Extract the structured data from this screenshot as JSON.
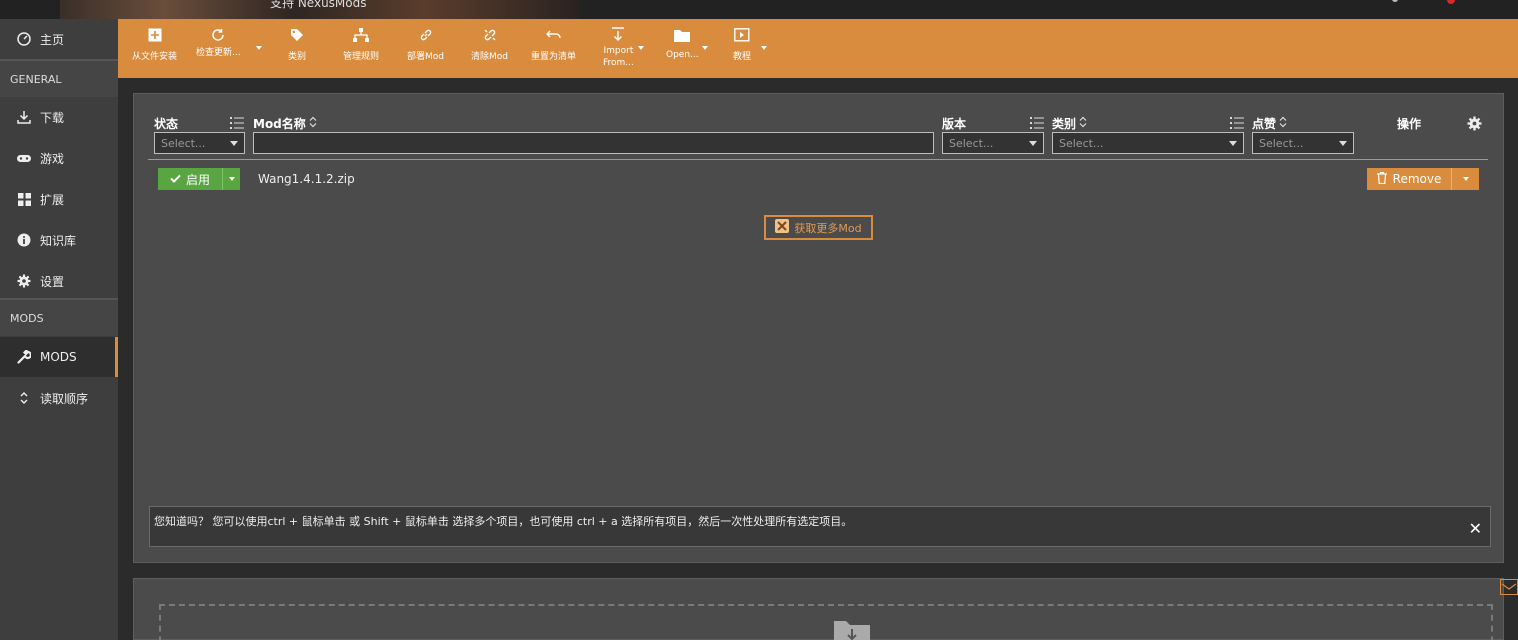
{
  "banner": {
    "text": "支持 NexusMods"
  },
  "sidebar": {
    "items": [
      {
        "label": "主页",
        "icon": "dashboard-icon"
      },
      {
        "label": "下载",
        "icon": "download-icon"
      },
      {
        "label": "游戏",
        "icon": "gamepad-icon"
      },
      {
        "label": "扩展",
        "icon": "grid-icon"
      },
      {
        "label": "知识库",
        "icon": "info-icon"
      },
      {
        "label": "设置",
        "icon": "gear-icon"
      },
      {
        "label": "MODS",
        "icon": "wrench-icon"
      },
      {
        "label": "读取顺序",
        "icon": "sort-icon"
      }
    ],
    "sections": [
      "GENERAL",
      "MODS"
    ],
    "active": "MODS",
    "accent": "#d98c3e"
  },
  "toolbar": {
    "buttons": [
      {
        "label": "从文件安装",
        "icon": "plus-square-icon"
      },
      {
        "label": "检查更新...",
        "icon": "refresh-icon"
      },
      {
        "label": "类别",
        "icon": "tag-icon"
      },
      {
        "label": "管理规则",
        "icon": "hierarchy-icon"
      },
      {
        "label": "部署Mod",
        "icon": "link-icon"
      },
      {
        "label": "清除Mod",
        "icon": "unlink-icon"
      },
      {
        "label": "重置为清单",
        "icon": "undo-icon"
      },
      {
        "label_line1": "Import",
        "label_line2": "From...",
        "icon": "import-icon"
      },
      {
        "label": "Open...",
        "icon": "folder-icon"
      },
      {
        "label": "教程",
        "icon": "video-icon"
      }
    ],
    "color": "#d98c3e"
  },
  "table": {
    "headers": {
      "status": "状态",
      "name": "Mod名称",
      "version": "版本",
      "category": "类别",
      "endorse": "点赞",
      "actions": "操作"
    },
    "filters": {
      "status": "Select...",
      "version": "Select...",
      "category": "Select...",
      "endorse": "Select...",
      "name": ""
    },
    "rows": [
      {
        "status": "启用",
        "name": "Wang1.4.1.2.zip",
        "action": "Remove"
      }
    ]
  },
  "getmore": {
    "label": "获取更多Mod"
  },
  "tip": {
    "text": "您知道吗？ 您可以使用ctrl + 鼠标单击 或 Shift + 鼠标单击 选择多个项目，也可使用 ctrl + a 选择所有项目，然后一次性处理所有选定项目。"
  },
  "colors": {
    "enable": "#58a541",
    "accent": "#d98c3e",
    "panel": "#4b4b4b"
  }
}
